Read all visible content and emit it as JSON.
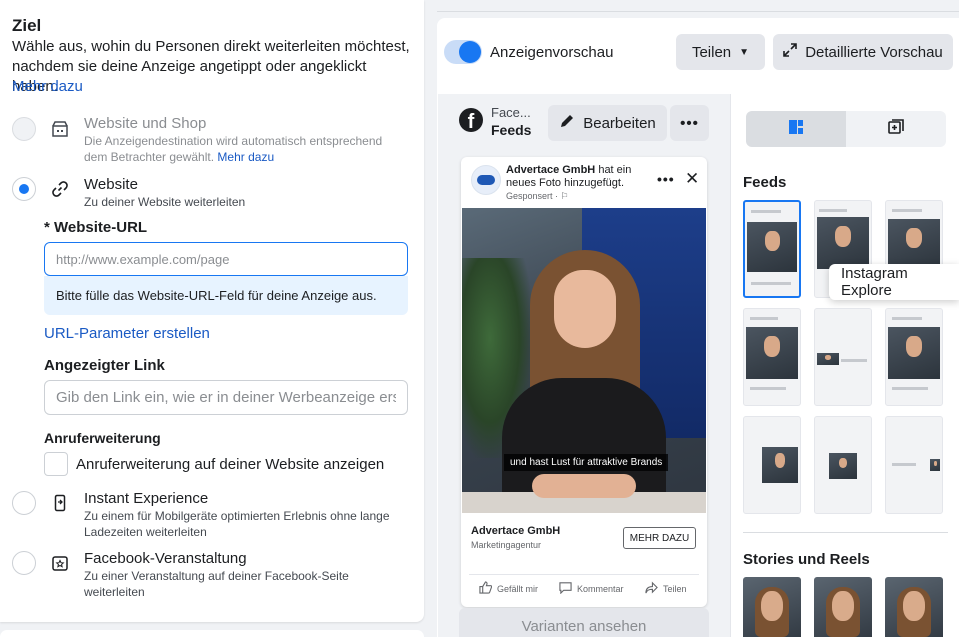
{
  "left": {
    "title": "Ziel",
    "description": "Wähle aus, wohin du Personen direkt weiterleiten möchtest, nachdem sie deine Anzeige angetippt oder angeklickt haben.",
    "more_link": "Mehr dazu",
    "options": [
      {
        "title": "Website und Shop",
        "subtitle": "Die Anzeigendestination wird automatisch entsprechend dem Betrachter gewählt.",
        "more": "Mehr dazu",
        "state": "disabled",
        "icon": "storefront-icon"
      },
      {
        "title": "Website",
        "subtitle": "Zu deiner Website weiterleiten",
        "state": "checked",
        "icon": "link-icon"
      },
      {
        "title": "Instant Experience",
        "subtitle": "Zu einem für Mobilgeräte optimierten Erlebnis ohne lange Ladezeiten weiterleiten",
        "state": "unchecked",
        "icon": "phone-icon"
      },
      {
        "title": "Facebook-Veranstaltung",
        "subtitle": "Zu einer Veranstaltung auf deiner Facebook-Seite weiterleiten",
        "state": "unchecked",
        "icon": "event-star-icon"
      }
    ],
    "url_label": "* Website-URL",
    "url_placeholder": "http://www.example.com/page",
    "url_hint": "Bitte fülle das Website-URL-Feld für deine Anzeige aus.",
    "url_params_link": "URL-Parameter erstellen",
    "display_link_label": "Angezeigter Link",
    "display_link_placeholder": "Gib den Link ein, wie er in deiner Werbeanzeige ersch...",
    "call_ext_label": "Anruferweiterung",
    "call_ext_checkbox": "Anruferweiterung auf deiner Website anzeigen"
  },
  "right": {
    "toggle_label": "Anzeigenvorschau",
    "share_label": "Teilen",
    "detail_label": "Detaillierte Vorschau",
    "platform_name": "Face...",
    "platform_placement": "Feeds",
    "edit_label": "Bearbeiten",
    "post": {
      "advertiser": "Advertace GmbH",
      "action": " hat ein neues Foto hinzugefügt.",
      "sponsored": "Gesponsert · ⚐",
      "caption": "und hast Lust für attraktive Brands",
      "page_name": "Advertace GmbH",
      "category": "Marketingagentur",
      "cta": "MEHR DAZU",
      "like": "Gefällt mir",
      "comment": "Kommentar",
      "share": "Teilen"
    },
    "variants_label": "Varianten ansehen",
    "feeds_title": "Feeds",
    "tooltip": "Instagram Explore",
    "stories_title": "Stories und Reels"
  },
  "colors": {
    "accent": "#1877f2",
    "link": "#1a5ac4",
    "hint_bg": "#e7f3ff"
  }
}
